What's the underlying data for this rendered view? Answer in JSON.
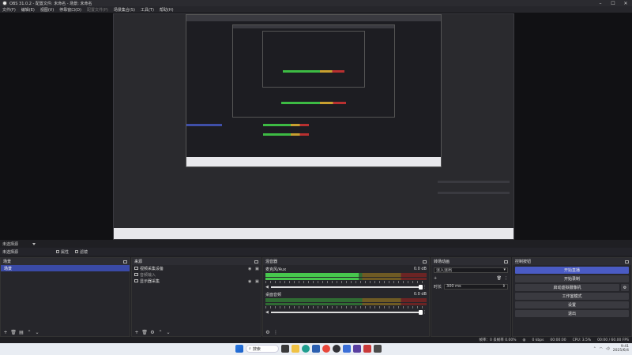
{
  "window": {
    "title": "OBS 31.0.2 - 配置文件: 未命名 - 场景: 未命名"
  },
  "menu": [
    {
      "label": "文件(F)",
      "disabled": false
    },
    {
      "label": "编辑(E)",
      "disabled": false
    },
    {
      "label": "视图(V)",
      "disabled": false
    },
    {
      "label": "停靠窗口(D)",
      "disabled": false
    },
    {
      "label": "配置文件(P)",
      "disabled": true
    },
    {
      "label": "场景集合(S)",
      "disabled": false
    },
    {
      "label": "工具(T)",
      "disabled": false
    },
    {
      "label": "帮助(H)",
      "disabled": false
    }
  ],
  "scene_bar": {
    "label": "未选择源"
  },
  "source_bar": {
    "properties": "属性",
    "filters": "滤镜",
    "source_name": "未选择源"
  },
  "scenes": {
    "title": "场景",
    "items": [
      "场景"
    ]
  },
  "sources": {
    "title": "来源",
    "items": [
      "视频采集设备",
      "音频输入",
      "显示器采集"
    ]
  },
  "mixer": {
    "title": "混音器",
    "channels": [
      {
        "name": "麦克风/Aux",
        "db": "0.0 dB",
        "level": 0.58
      },
      {
        "name": "桌面音频",
        "db": "0.0 dB",
        "level": 0.0
      }
    ]
  },
  "transitions": {
    "title": "转场动画",
    "type": "淡入淡出",
    "duration_label": "时长",
    "duration": "300 ms"
  },
  "controls": {
    "title": "控制按钮",
    "buttons": [
      "开始直播",
      "开始录制",
      "启动虚拟摄像机",
      "工作室模式",
      "设置",
      "退出"
    ]
  },
  "status": {
    "stats": "帧率：0 丢帧率 0.00%",
    "kbps": "0 kbps",
    "rec": "00:00:00",
    "cpu": "CPU: 3.5%",
    "fps": "00:00 / 60.00 FPS"
  },
  "taskbar": {
    "search": "搜索",
    "time": "9:41",
    "date": "2025/6/4"
  },
  "colors": {
    "accent": "#4a5bc4",
    "meter_green": "#47c84d",
    "meter_yellow": "#c8a030",
    "meter_red": "#b83030"
  }
}
